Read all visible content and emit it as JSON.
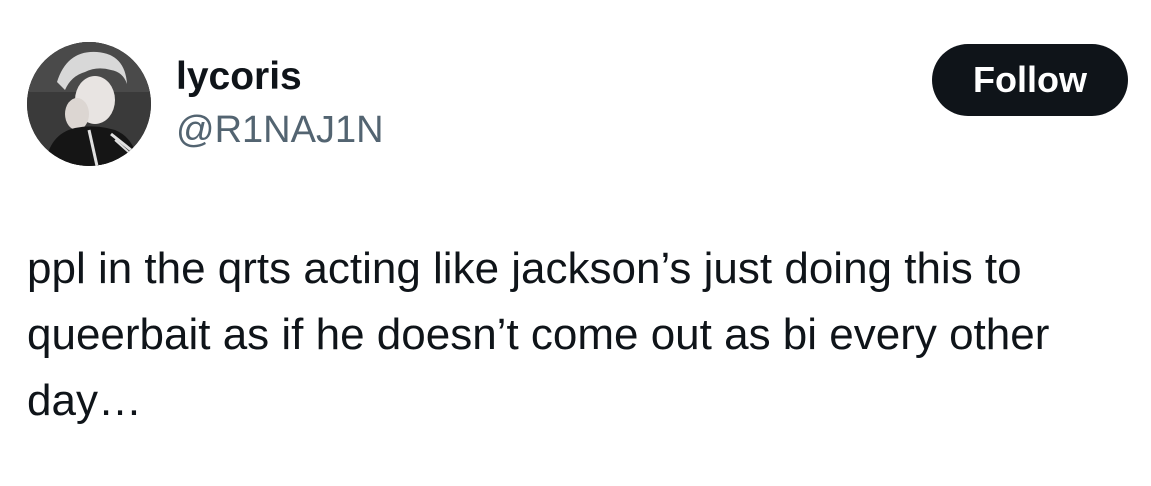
{
  "author": {
    "display_name": "lycoris",
    "handle": "@R1NAJ1N",
    "avatar_icon": "profile-photo-avatar"
  },
  "actions": {
    "follow_label": "Follow"
  },
  "tweet": {
    "lines": [
      "ppl in the qrts acting like jackson’s just doing this to",
      "queerbait as if he doesn’t come out as bi every other",
      "day…"
    ]
  },
  "colors": {
    "text_primary": "#0f1419",
    "text_secondary": "#536471",
    "button_bg": "#0f1419",
    "button_text": "#ffffff",
    "background": "#ffffff"
  }
}
